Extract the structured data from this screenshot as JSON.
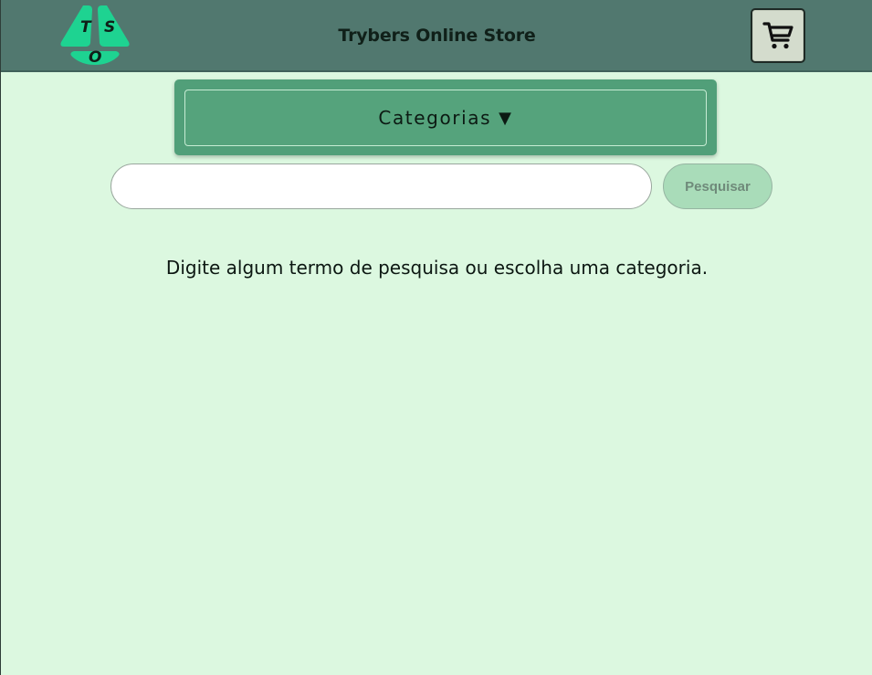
{
  "header": {
    "logo_letters": [
      "T",
      "S",
      "O"
    ],
    "title": "Trybers Online Store",
    "cart_icon": "shopping-cart-icon"
  },
  "categories": {
    "label": "Categorias",
    "arrow": "▼"
  },
  "search": {
    "value": "",
    "placeholder": "",
    "button_label": "Pesquisar"
  },
  "main": {
    "hint": "Digite algum termo de pesquisa ou escolha uma categoria."
  },
  "colors": {
    "header_bg": "#51786f",
    "page_bg": "#dcf8e0",
    "logo_green": "#1ed391",
    "categories_bg": "#519f79",
    "search_button_bg": "#a9dcb9"
  }
}
